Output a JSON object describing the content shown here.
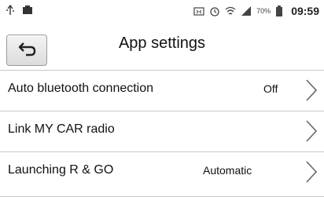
{
  "status_bar": {
    "icons_left": [
      "usb-icon",
      "sd-card-icon"
    ],
    "icons_right": [
      "screenshot-icon",
      "alarm-icon",
      "wifi-icon",
      "signal-icon",
      "battery-icon"
    ],
    "battery": "70%",
    "time": "09:59"
  },
  "header": {
    "title": "App settings",
    "back_icon": "back-arrow-icon"
  },
  "settings": [
    {
      "label": "Auto bluetooth connection",
      "value": "Off"
    },
    {
      "label": "Link MY CAR radio",
      "value": ""
    },
    {
      "label": "Launching R & GO",
      "value": "Automatic"
    }
  ]
}
